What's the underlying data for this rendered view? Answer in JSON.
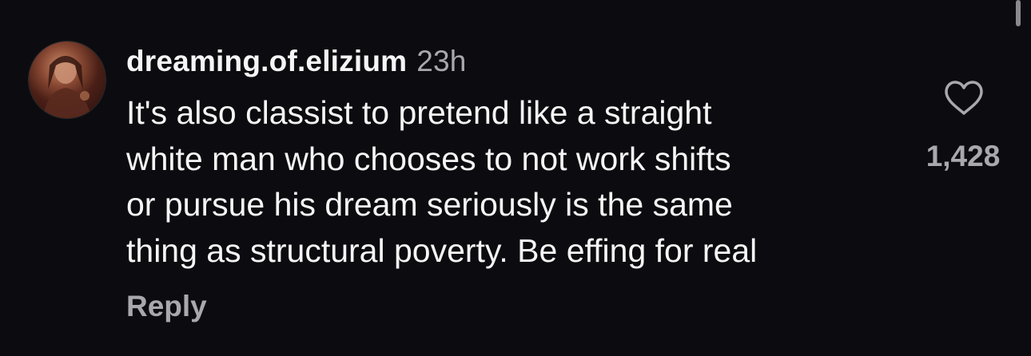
{
  "comment": {
    "username": "dreaming.of.elizium",
    "time": "23h",
    "text_lines": [
      "It's also classist to pretend like a straight",
      "white man who chooses to not work shifts",
      "or pursue his dream seriously is the same",
      "thing as structural poverty. Be effing for real"
    ],
    "reply_label": "Reply",
    "like_count": "1,428",
    "like_icon": "heart-outline-icon",
    "avatar_icon": "user-avatar"
  },
  "colors": {
    "background": "#0c0c10",
    "primary_text": "#f5f5f5",
    "secondary_text": "#a8a8ad"
  }
}
